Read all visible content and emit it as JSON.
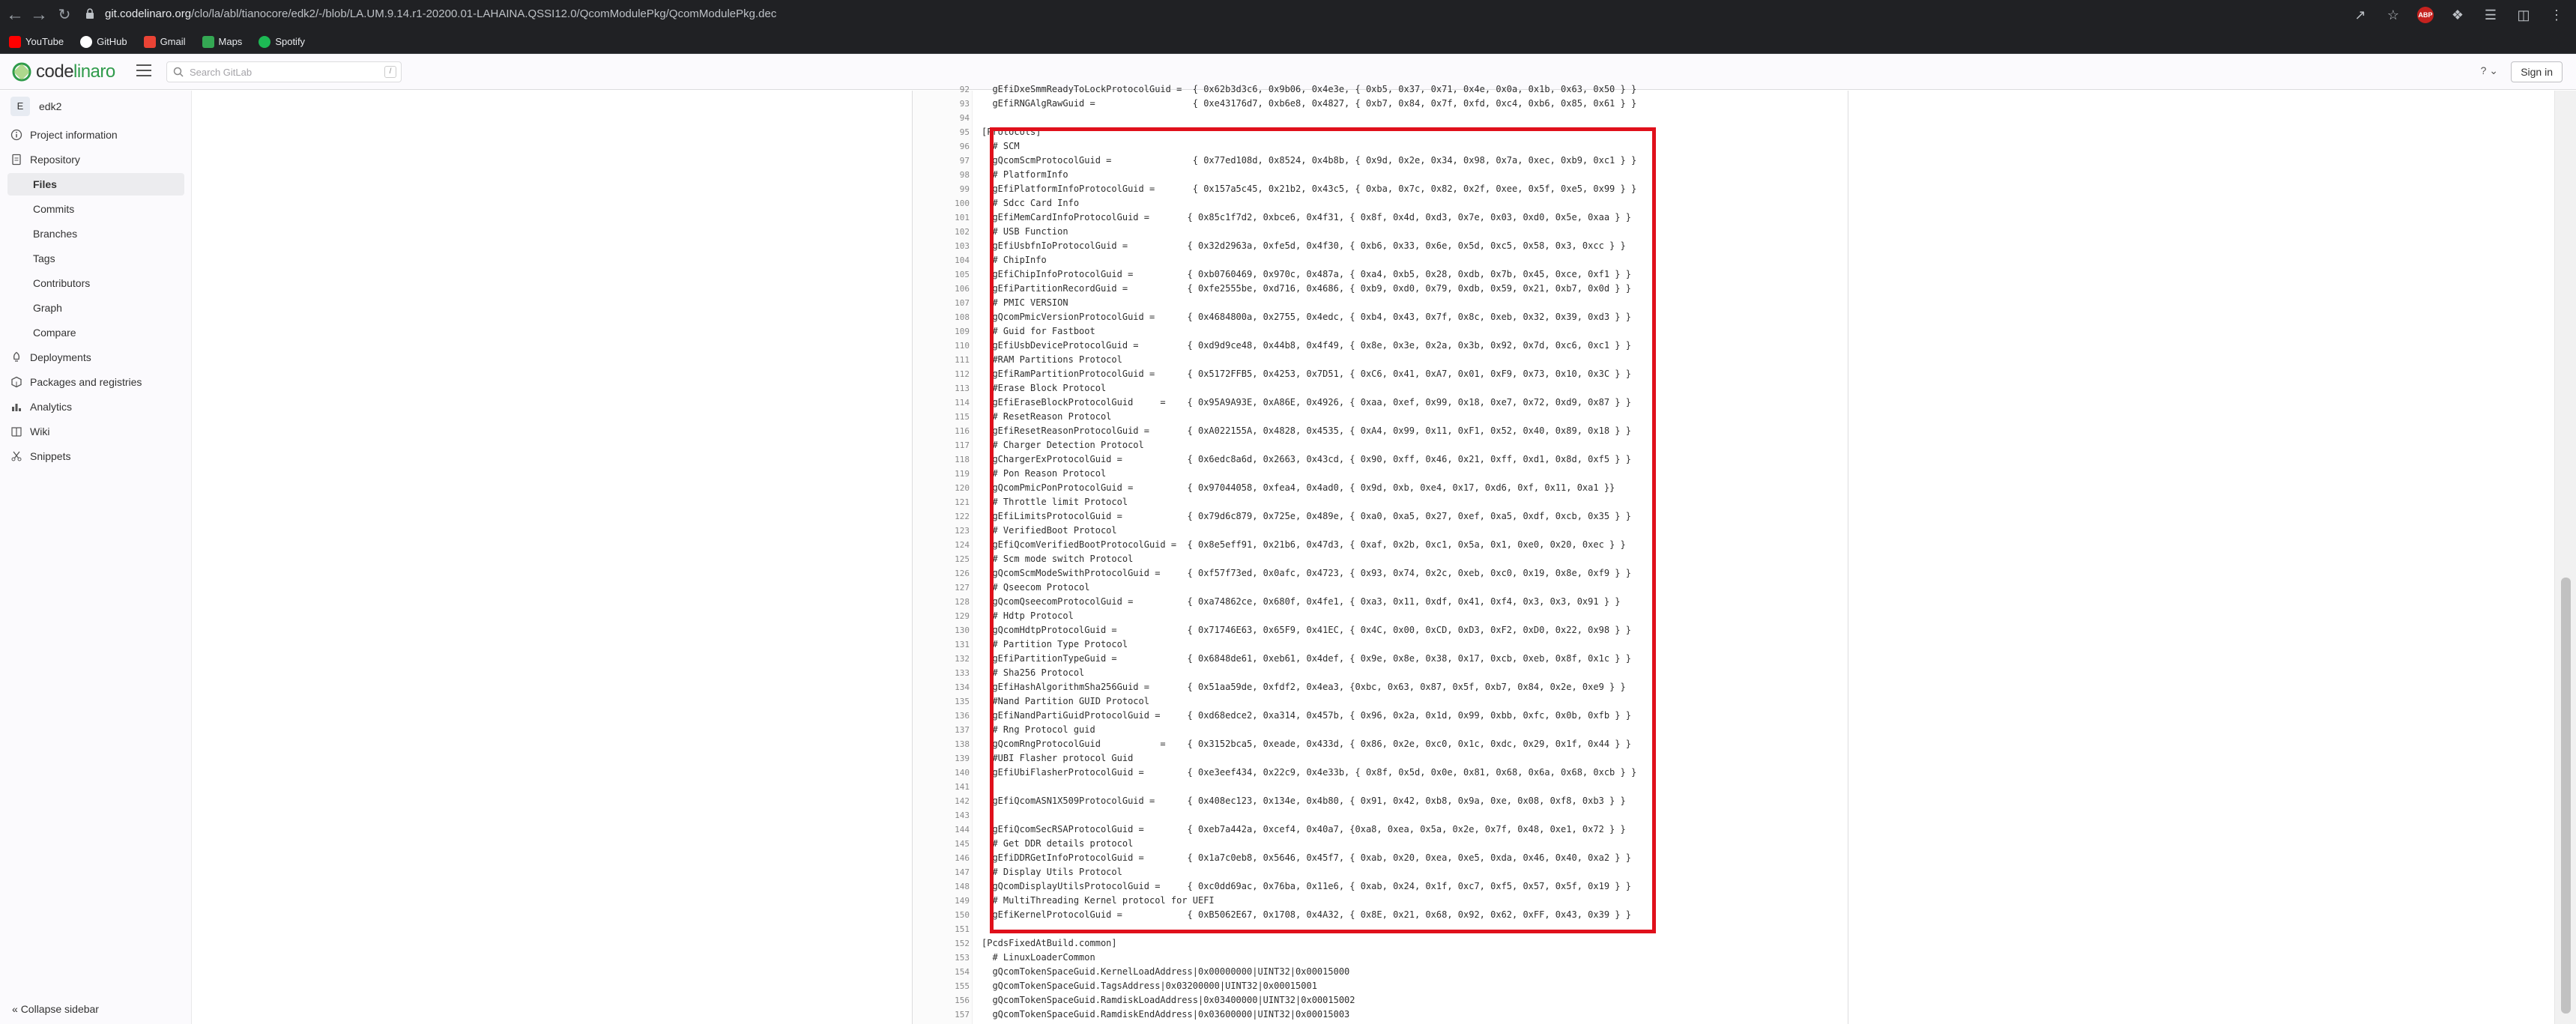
{
  "browser": {
    "url_host": "git.codelinaro.org",
    "url_path": "/clo/la/abl/tianocore/edk2/-/blob/LA.UM.9.14.r1-20200.01-LAHAINA.QSSI12.0/QcomModulePkg/QcomModulePkg.dec",
    "bookmarks": [
      {
        "label": "YouTube",
        "color": "#ff0000"
      },
      {
        "label": "GitHub",
        "color": "#ffffff"
      },
      {
        "label": "Gmail",
        "color": "#ea4335"
      },
      {
        "label": "Maps",
        "color": "#34a853"
      },
      {
        "label": "Spotify",
        "color": "#1db954"
      }
    ]
  },
  "header": {
    "logo_text_a": "code",
    "logo_text_b": "linaro",
    "search_placeholder": "Search GitLab",
    "search_kbd": "/",
    "help_label": "?",
    "signin_label": "Sign in"
  },
  "sidebar": {
    "project_initial": "E",
    "project_name": "edk2",
    "items": [
      {
        "label": "Project information",
        "icon": "info-icon"
      },
      {
        "label": "Repository",
        "icon": "doc-icon"
      },
      {
        "label": "Files",
        "sub": true,
        "active": true
      },
      {
        "label": "Commits",
        "sub": true
      },
      {
        "label": "Branches",
        "sub": true
      },
      {
        "label": "Tags",
        "sub": true
      },
      {
        "label": "Contributors",
        "sub": true
      },
      {
        "label": "Graph",
        "sub": true
      },
      {
        "label": "Compare",
        "sub": true
      },
      {
        "label": "Deployments",
        "icon": "rocket-icon"
      },
      {
        "label": "Packages and registries",
        "icon": "package-icon"
      },
      {
        "label": "Analytics",
        "icon": "chart-icon"
      },
      {
        "label": "Wiki",
        "icon": "book-icon"
      },
      {
        "label": "Snippets",
        "icon": "scissors-icon"
      }
    ],
    "collapse_label": "Collapse sidebar"
  },
  "code": {
    "lines": [
      {
        "n": "92",
        "t": "  gEfiDxeSmmReadyToLockProtocolGuid =  { 0x62b3d3c6, 0x9b06, 0x4e3e, { 0xb5, 0x37, 0x71, 0x4e, 0x0a, 0x1b, 0x63, 0x50 } }"
      },
      {
        "n": "93",
        "t": "  gEfiRNGAlgRawGuid =                  { 0xe43176d7, 0xb6e8, 0x4827, { 0xb7, 0x84, 0x7f, 0xfd, 0xc4, 0xb6, 0x85, 0x61 } }"
      },
      {
        "n": "94",
        "t": ""
      },
      {
        "n": "95",
        "t": "[Protocols]"
      },
      {
        "n": "96",
        "t": "  # SCM"
      },
      {
        "n": "97",
        "t": "  gQcomScmProtocolGuid =               { 0x77ed108d, 0x8524, 0x4b8b, { 0x9d, 0x2e, 0x34, 0x98, 0x7a, 0xec, 0xb9, 0xc1 } }"
      },
      {
        "n": "98",
        "t": "  # PlatformInfo"
      },
      {
        "n": "99",
        "t": "  gEfiPlatformInfoProtocolGuid =       { 0x157a5c45, 0x21b2, 0x43c5, { 0xba, 0x7c, 0x82, 0x2f, 0xee, 0x5f, 0xe5, 0x99 } }"
      },
      {
        "n": "100",
        "t": "  # Sdcc Card Info"
      },
      {
        "n": "101",
        "t": "  gEfiMemCardInfoProtocolGuid =       { 0x85c1f7d2, 0xbce6, 0x4f31, { 0x8f, 0x4d, 0xd3, 0x7e, 0x03, 0xd0, 0x5e, 0xaa } }"
      },
      {
        "n": "102",
        "t": "  # USB Function"
      },
      {
        "n": "103",
        "t": "  gEfiUsbfnIoProtocolGuid =           { 0x32d2963a, 0xfe5d, 0x4f30, { 0xb6, 0x33, 0x6e, 0x5d, 0xc5, 0x58, 0x3, 0xcc } }"
      },
      {
        "n": "104",
        "t": "  # ChipInfo"
      },
      {
        "n": "105",
        "t": "  gEfiChipInfoProtocolGuid =          { 0xb0760469, 0x970c, 0x487a, { 0xa4, 0xb5, 0x28, 0xdb, 0x7b, 0x45, 0xce, 0xf1 } }"
      },
      {
        "n": "106",
        "t": "  gEfiPartitionRecordGuid =           { 0xfe2555be, 0xd716, 0x4686, { 0xb9, 0xd0, 0x79, 0xdb, 0x59, 0x21, 0xb7, 0x0d } }"
      },
      {
        "n": "107",
        "t": "  # PMIC VERSION"
      },
      {
        "n": "108",
        "t": "  gQcomPmicVersionProtocolGuid =      { 0x4684800a, 0x2755, 0x4edc, { 0xb4, 0x43, 0x7f, 0x8c, 0xeb, 0x32, 0x39, 0xd3 } }"
      },
      {
        "n": "109",
        "t": "  # Guid for Fastboot"
      },
      {
        "n": "110",
        "t": "  gEfiUsbDeviceProtocolGuid =         { 0xd9d9ce48, 0x44b8, 0x4f49, { 0x8e, 0x3e, 0x2a, 0x3b, 0x92, 0x7d, 0xc6, 0xc1 } }"
      },
      {
        "n": "111",
        "t": "  #RAM Partitions Protocol"
      },
      {
        "n": "112",
        "t": "  gEfiRamPartitionProtocolGuid =      { 0x5172FFB5, 0x4253, 0x7D51, { 0xC6, 0x41, 0xA7, 0x01, 0xF9, 0x73, 0x10, 0x3C } }"
      },
      {
        "n": "113",
        "t": "  #Erase Block Protocol"
      },
      {
        "n": "114",
        "t": "  gEfiEraseBlockProtocolGuid     =    { 0x95A9A93E, 0xA86E, 0x4926, { 0xaa, 0xef, 0x99, 0x18, 0xe7, 0x72, 0xd9, 0x87 } }"
      },
      {
        "n": "115",
        "t": "  # ResetReason Protocol"
      },
      {
        "n": "116",
        "t": "  gEfiResetReasonProtocolGuid =       { 0xA022155A, 0x4828, 0x4535, { 0xA4, 0x99, 0x11, 0xF1, 0x52, 0x40, 0x89, 0x18 } }"
      },
      {
        "n": "117",
        "t": "  # Charger Detection Protocol"
      },
      {
        "n": "118",
        "t": "  gChargerExProtocolGuid =            { 0x6edc8a6d, 0x2663, 0x43cd, { 0x90, 0xff, 0x46, 0x21, 0xff, 0xd1, 0x8d, 0xf5 } }"
      },
      {
        "n": "119",
        "t": "  # Pon Reason Protocol"
      },
      {
        "n": "120",
        "t": "  gQcomPmicPonProtocolGuid =          { 0x97044058, 0xfea4, 0x4ad0, { 0x9d, 0xb, 0xe4, 0x17, 0xd6, 0xf, 0x11, 0xa1 }}"
      },
      {
        "n": "121",
        "t": "  # Throttle limit Protocol"
      },
      {
        "n": "122",
        "t": "  gEfiLimitsProtocolGuid =            { 0x79d6c879, 0x725e, 0x489e, { 0xa0, 0xa5, 0x27, 0xef, 0xa5, 0xdf, 0xcb, 0x35 } }"
      },
      {
        "n": "123",
        "t": "  # VerifiedBoot Protocol"
      },
      {
        "n": "124",
        "t": "  gEfiQcomVerifiedBootProtocolGuid =  { 0x8e5eff91, 0x21b6, 0x47d3, { 0xaf, 0x2b, 0xc1, 0x5a, 0x1, 0xe0, 0x20, 0xec } }"
      },
      {
        "n": "125",
        "t": "  # Scm mode switch Protocol"
      },
      {
        "n": "126",
        "t": "  gQcomScmModeSwithProtocolGuid =     { 0xf57f73ed, 0x0afc, 0x4723, { 0x93, 0x74, 0x2c, 0xeb, 0xc0, 0x19, 0x8e, 0xf9 } }"
      },
      {
        "n": "127",
        "t": "  # Qseecom Protocol"
      },
      {
        "n": "128",
        "t": "  gQcomQseecomProtocolGuid =          { 0xa74862ce, 0x680f, 0x4fe1, { 0xa3, 0x11, 0xdf, 0x41, 0xf4, 0x3, 0x3, 0x91 } }"
      },
      {
        "n": "129",
        "t": "  # Hdtp Protocol"
      },
      {
        "n": "130",
        "t": "  gQcomHdtpProtocolGuid =             { 0x71746E63, 0x65F9, 0x41EC, { 0x4C, 0x00, 0xCD, 0xD3, 0xF2, 0xD0, 0x22, 0x98 } }"
      },
      {
        "n": "131",
        "t": "  # Partition Type Protocol"
      },
      {
        "n": "132",
        "t": "  gEfiPartitionTypeGuid =             { 0x6848de61, 0xeb61, 0x4def, { 0x9e, 0x8e, 0x38, 0x17, 0xcb, 0xeb, 0x8f, 0x1c } }"
      },
      {
        "n": "133",
        "t": "  # Sha256 Protocol"
      },
      {
        "n": "134",
        "t": "  gEfiHashAlgorithmSha256Guid =       { 0x51aa59de, 0xfdf2, 0x4ea3, {0xbc, 0x63, 0x87, 0x5f, 0xb7, 0x84, 0x2e, 0xe9 } }"
      },
      {
        "n": "135",
        "t": "  #Nand Partition GUID Protocol"
      },
      {
        "n": "136",
        "t": "  gEfiNandPartiGuidProtocolGuid =     { 0xd68edce2, 0xa314, 0x457b, { 0x96, 0x2a, 0x1d, 0x99, 0xbb, 0xfc, 0x0b, 0xfb } }"
      },
      {
        "n": "137",
        "t": "  # Rng Protocol guid"
      },
      {
        "n": "138",
        "t": "  gQcomRngProtocolGuid           =    { 0x3152bca5, 0xeade, 0x433d, { 0x86, 0x2e, 0xc0, 0x1c, 0xdc, 0x29, 0x1f, 0x44 } }"
      },
      {
        "n": "139",
        "t": "  #UBI Flasher protocol Guid"
      },
      {
        "n": "140",
        "t": "  gEfiUbiFlasherProtocolGuid =        { 0xe3eef434, 0x22c9, 0x4e33b, { 0x8f, 0x5d, 0x0e, 0x81, 0x68, 0x6a, 0x68, 0xcb } }"
      },
      {
        "n": "141",
        "t": ""
      },
      {
        "n": "142",
        "t": "  gEfiQcomASN1X509ProtocolGuid =      { 0x408ec123, 0x134e, 0x4b80, { 0x91, 0x42, 0xb8, 0x9a, 0xe, 0x08, 0xf8, 0xb3 } }"
      },
      {
        "n": "143",
        "t": ""
      },
      {
        "n": "144",
        "t": "  gEfiQcomSecRSAProtocolGuid =        { 0xeb7a442a, 0xcef4, 0x40a7, {0xa8, 0xea, 0x5a, 0x2e, 0x7f, 0x48, 0xe1, 0x72 } }"
      },
      {
        "n": "145",
        "t": "  # Get DDR details protocol"
      },
      {
        "n": "146",
        "t": "  gEfiDDRGetInfoProtocolGuid =        { 0x1a7c0eb8, 0x5646, 0x45f7, { 0xab, 0x20, 0xea, 0xe5, 0xda, 0x46, 0x40, 0xa2 } }"
      },
      {
        "n": "147",
        "t": "  # Display Utils Protocol"
      },
      {
        "n": "148",
        "t": "  gQcomDisplayUtilsProtocolGuid =     { 0xc0dd69ac, 0x76ba, 0x11e6, { 0xab, 0x24, 0x1f, 0xc7, 0xf5, 0x57, 0x5f, 0x19 } }"
      },
      {
        "n": "149",
        "t": "  # MultiThreading Kernel protocol for UEFI"
      },
      {
        "n": "150",
        "t": "  gEfiKernelProtocolGuid =            { 0xB5062E67, 0x1708, 0x4A32, { 0x8E, 0x21, 0x68, 0x92, 0x62, 0xFF, 0x43, 0x39 } }"
      },
      {
        "n": "151",
        "t": ""
      },
      {
        "n": "152",
        "t": "[PcdsFixedAtBuild.common]"
      },
      {
        "n": "153",
        "t": "  # LinuxLoaderCommon"
      },
      {
        "n": "154",
        "t": "  gQcomTokenSpaceGuid.KernelLoadAddress|0x00000000|UINT32|0x00015000"
      },
      {
        "n": "155",
        "t": "  gQcomTokenSpaceGuid.TagsAddress|0x03200000|UINT32|0x00015001"
      },
      {
        "n": "156",
        "t": "  gQcomTokenSpaceGuid.RamdiskLoadAddress|0x03400000|UINT32|0x00015002"
      },
      {
        "n": "157",
        "t": "  gQcomTokenSpaceGuid.RamdiskEndAddress|0x03600000|UINT32|0x00015003"
      }
    ]
  },
  "colors": {
    "highlight_border": "#e0101b",
    "brand_green": "#2f9b4b"
  }
}
